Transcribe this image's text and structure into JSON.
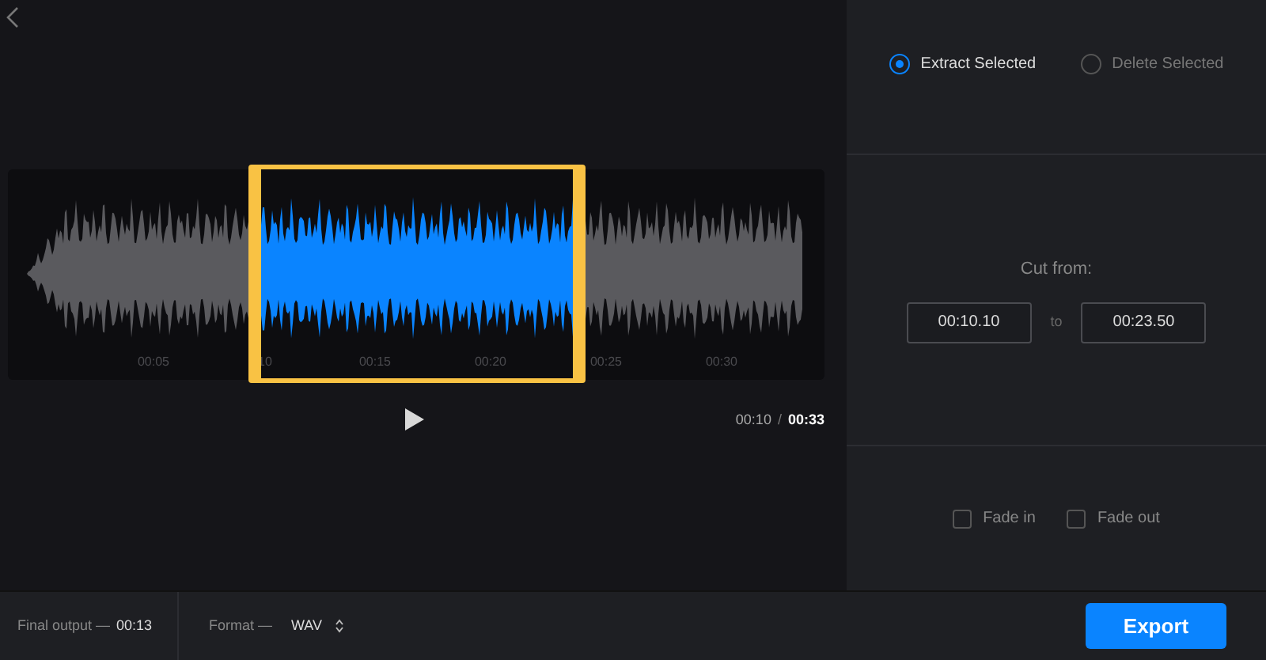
{
  "timeline": {
    "ticks": [
      "00:05",
      "10",
      "00:15",
      "00:20",
      "00:25",
      "00:30"
    ]
  },
  "playback": {
    "current": "00:10",
    "separator": "/",
    "total": "00:33"
  },
  "modes": [
    {
      "label": "Extract Selected",
      "selected": true
    },
    {
      "label": "Delete Selected",
      "selected": false
    }
  ],
  "cut": {
    "label": "Cut from:",
    "start": "00:10.10",
    "joiner": "to",
    "end": "00:23.50"
  },
  "fades": [
    {
      "label": "Fade in",
      "checked": false
    },
    {
      "label": "Fade out",
      "checked": false
    }
  ],
  "footer": {
    "output_label": "Final output —",
    "output_value": "00:13",
    "format_label": "Format —",
    "format_value": "WAV",
    "export": "Export"
  }
}
